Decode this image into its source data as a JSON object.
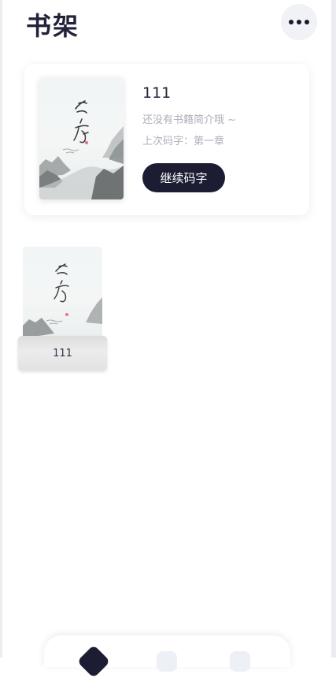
{
  "header": {
    "title": "书架",
    "more_icon": "more-horizontal-icon"
  },
  "featured_book": {
    "title": "111",
    "intro": "还没有书籍简介哦 ~",
    "last_chapter": "上次码字：第一章",
    "continue_label": "继续码字",
    "cover_art": "ink-mountain-landscape"
  },
  "shelf": {
    "books": [
      {
        "title": "111",
        "cover_art": "ink-mountain-landscape"
      }
    ]
  },
  "bottom_nav": {
    "tabs": [
      {
        "icon": "bookshelf-icon",
        "active": true
      },
      {
        "icon": "tab-icon",
        "active": false
      },
      {
        "icon": "tab-icon",
        "active": false
      }
    ]
  },
  "colors": {
    "primary_dark": "#1c1d33",
    "muted_text": "#aeb0bb",
    "button_bg": "#f1f2f6"
  }
}
